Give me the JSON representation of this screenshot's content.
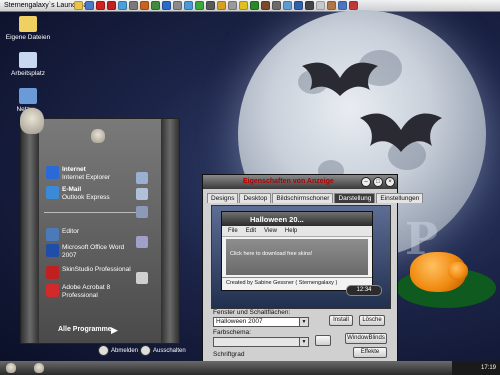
{
  "launchbar": {
    "title": "Sternengalaxy`s Launchbar",
    "icons": [
      {
        "name": "folder-icon",
        "color": "#e8c44a"
      },
      {
        "name": "mail-icon",
        "color": "#4a7ac8"
      },
      {
        "name": "pdf-icon",
        "color": "#d02020"
      },
      {
        "name": "skin-icon",
        "color": "#c02020"
      },
      {
        "name": "image-icon",
        "color": "#4aa0d8"
      },
      {
        "name": "calc-icon",
        "color": "#7a7a7a"
      },
      {
        "name": "paint-icon",
        "color": "#c86420"
      },
      {
        "name": "media-icon",
        "color": "#3c8c3c"
      },
      {
        "name": "browser-icon",
        "color": "#2a6ac8"
      },
      {
        "name": "search-icon",
        "color": "#8a8a8a"
      },
      {
        "name": "globe-icon",
        "color": "#4a9ad8"
      },
      {
        "name": "chat-icon",
        "color": "#3aa83a"
      },
      {
        "name": "settings-icon",
        "color": "#5a5a5a"
      },
      {
        "name": "music-icon",
        "color": "#d8a020"
      },
      {
        "name": "disc-icon",
        "color": "#9a9a9a"
      },
      {
        "name": "star-icon",
        "color": "#e0c020"
      },
      {
        "name": "network-icon",
        "color": "#2a8a2a"
      },
      {
        "name": "tool-icon",
        "color": "#7a4a2a"
      },
      {
        "name": "printer-icon",
        "color": "#6a6a6a"
      },
      {
        "name": "cloud-icon",
        "color": "#5a9ad0"
      },
      {
        "name": "shield-icon",
        "color": "#2a5aa8"
      },
      {
        "name": "monitor-icon",
        "color": "#3a3a3a"
      },
      {
        "name": "clock-icon",
        "color": "#c8c8c8"
      },
      {
        "name": "user-icon",
        "color": "#b06a30"
      },
      {
        "name": "help-icon",
        "color": "#3a6ab8"
      },
      {
        "name": "power-icon",
        "color": "#c02020"
      }
    ]
  },
  "desktop_icons": [
    {
      "label": "Eigene Dateien",
      "color": "#f0d060"
    },
    {
      "label": "Arbeitsplatz",
      "color": "#c8d8f0"
    },
    {
      "label": "Netzw...",
      "color": "#6a9ad8"
    }
  ],
  "start_menu": {
    "items": [
      {
        "title": "Internet",
        "subtitle": "Internet Explorer",
        "color": "#2a6ad8"
      },
      {
        "title": "E-Mail",
        "subtitle": "Outlook Express",
        "color": "#3a8ad8"
      },
      {
        "title": "Editor",
        "subtitle": "",
        "color": "#4a7ab8"
      },
      {
        "title": "Microsoft Office Word",
        "subtitle": "2007",
        "color": "#1f4ea8"
      },
      {
        "title": "SkinStudio Professional",
        "subtitle": "",
        "color": "#c02020"
      },
      {
        "title": "Adobe Acrobat 8",
        "subtitle": "Professional",
        "color": "#d02a2a"
      }
    ],
    "all_programs": "Alle Programme",
    "logoff": "Abmelden",
    "shutdown": "Ausschalten"
  },
  "dialog": {
    "title": "Eigenschaften von Anzeige",
    "tabs": [
      "Designs",
      "Desktop",
      "Bildschirmschoner",
      "Darstellung",
      "Einstellungen"
    ],
    "active_tab": "Darstellung",
    "preview": {
      "window_title": "Halloween 20...",
      "menu": [
        "File",
        "Edit",
        "View",
        "Help"
      ],
      "content": "Click here to download free skins!",
      "status": "Created by Sabine Gessner ( Sternengalaxy )"
    },
    "clock": "12:34",
    "label_windows": "Fenster und Schaltflächen:",
    "select_windows": "Halloween 2007",
    "label_color": "Farbschema:",
    "label_fontsize": "Schriftgrad",
    "btn_install": "Install",
    "btn_delete": "Lösche",
    "btn_windowblinds": "WindowBlinds",
    "btn_effects": "Effekte"
  },
  "taskbar": {
    "clock": "17:19"
  }
}
